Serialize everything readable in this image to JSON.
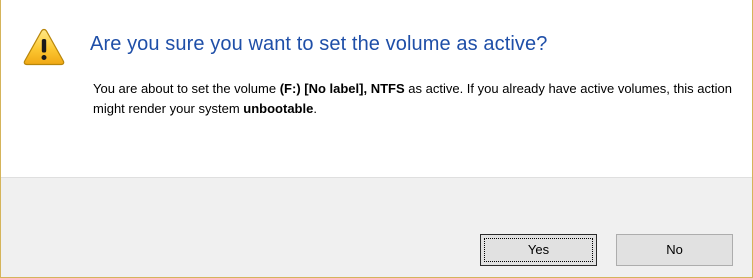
{
  "dialog": {
    "heading": "Are you sure you want to set the volume as active?",
    "message": {
      "part1": "You are about to set the volume ",
      "volume": "(F:) [No label], NTFS",
      "part2": " as active. If you already have active volumes, this action might render your system ",
      "emphasis": "unbootable",
      "part3": "."
    },
    "icon": "warning-icon",
    "accent_color": "#1f4fa8"
  },
  "buttons": {
    "yes_label": "Yes",
    "no_label": "No"
  }
}
